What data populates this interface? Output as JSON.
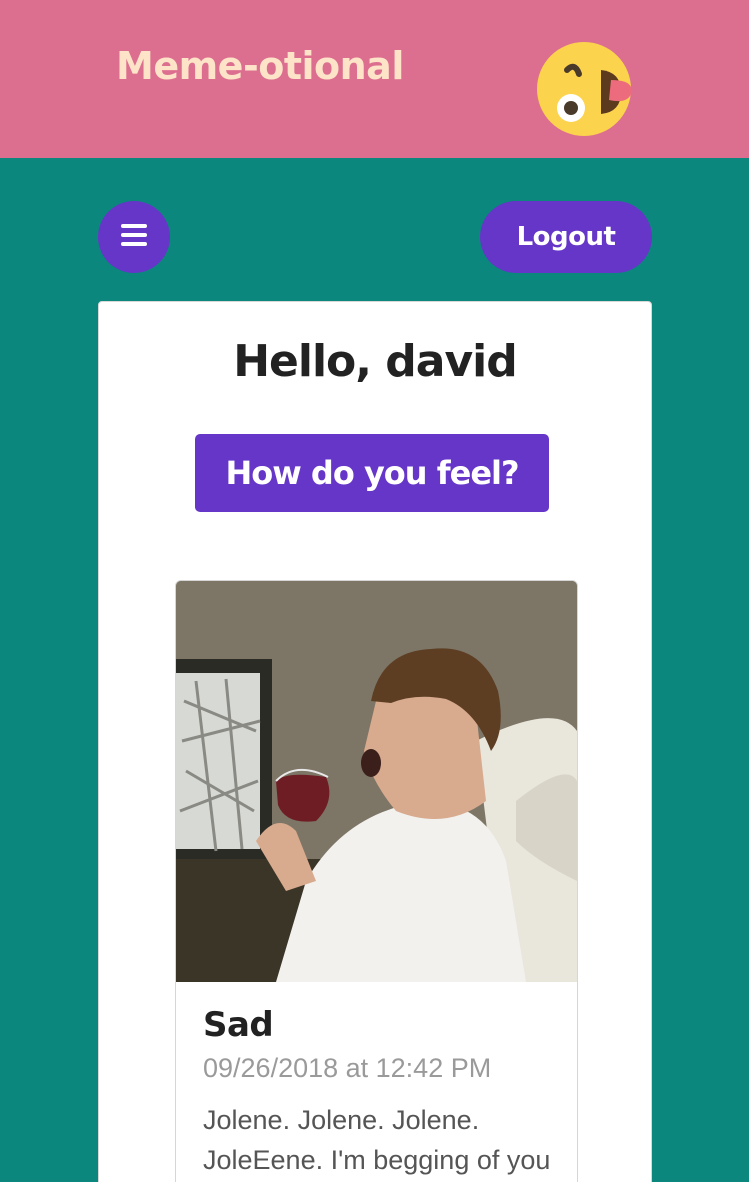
{
  "header": {
    "title": "Meme-otional",
    "logo_icon": "winking-tongue-face-icon",
    "colors": {
      "background": "#dc6f8f",
      "title": "#fde3c8"
    }
  },
  "toolbar": {
    "menu_icon": "hamburger-menu-icon",
    "logout_label": "Logout"
  },
  "main": {
    "greeting": "Hello, david",
    "feel_button_label": "How do you feel?"
  },
  "entries": [
    {
      "mood": "Sad",
      "timestamp": "09/26/2018 at 12:42 PM",
      "caption": "Jolene. Jolene. Jolene. JoleEene. I'm begging of you"
    }
  ],
  "colors": {
    "page_background": "#0b877e",
    "accent": "#6636c8",
    "card_background": "#ffffff"
  }
}
